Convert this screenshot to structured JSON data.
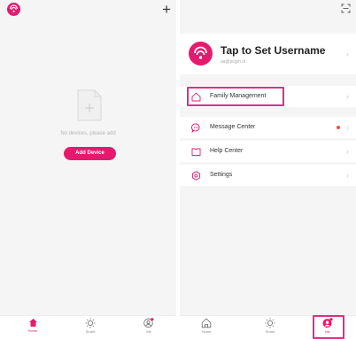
{
  "left": {
    "empty_text": "No devices, please add",
    "add_device_label": "Add Device",
    "plus_label": "+",
    "tabs": [
      {
        "label": "Home",
        "icon": "home-icon",
        "active": true
      },
      {
        "label": "Smart",
        "icon": "sun-icon",
        "active": false
      },
      {
        "label": "Me",
        "icon": "profile-icon",
        "active": false
      }
    ]
  },
  "right": {
    "profile": {
      "username": "Tap to Set Username",
      "email": "aa@pcgm.nl"
    },
    "menu": [
      {
        "label": "Family Management",
        "icon": "house-outline-icon"
      },
      {
        "label": "Message Center",
        "icon": "message-icon",
        "has_dot": true
      },
      {
        "label": "Help Center",
        "icon": "book-icon"
      },
      {
        "label": "Settings",
        "icon": "gear-icon"
      }
    ],
    "tabs": [
      {
        "label": "Home",
        "icon": "home-outline-icon",
        "active": false
      },
      {
        "label": "Smart",
        "icon": "sun-icon",
        "active": false
      },
      {
        "label": "Me",
        "icon": "profile-icon",
        "active": true
      }
    ]
  },
  "colors": {
    "accent": "#e5196d",
    "highlight": "#d63384",
    "background": "#f5f5f5",
    "dot": "#ff4d2e"
  }
}
